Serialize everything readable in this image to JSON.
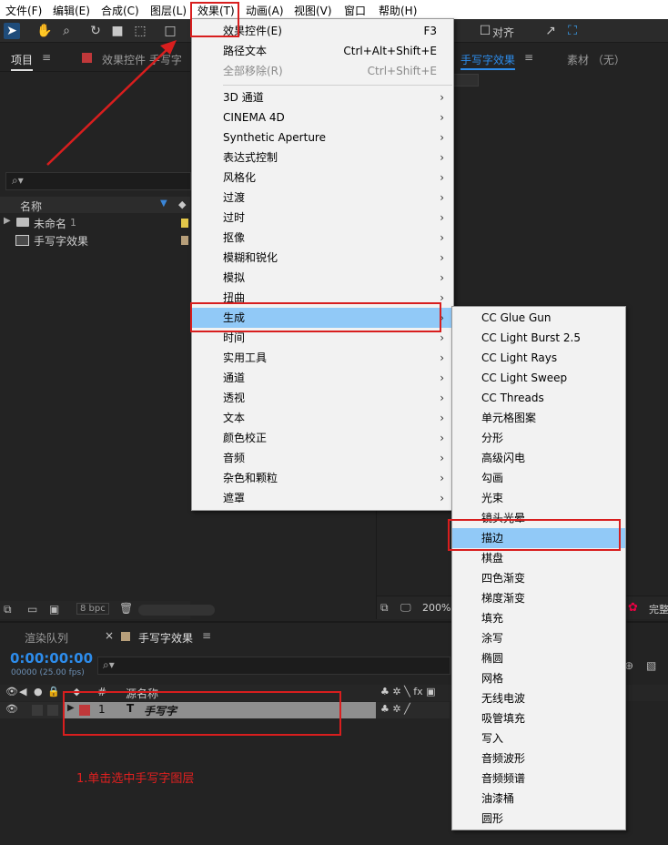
{
  "menubar": {
    "items": [
      "文件(F)",
      "编辑(E)",
      "合成(C)",
      "图层(L)",
      "效果(T)",
      "动画(A)",
      "视图(V)",
      "窗口",
      "帮助(H)"
    ]
  },
  "toolbar": {
    "align_label": "对齐"
  },
  "project_panel": {
    "tab_project": "项目",
    "tab_effect_controls": "效果控件 手写字",
    "col_name": "名称",
    "items": [
      {
        "name": "未命名",
        "count": "1"
      },
      {
        "name": "手写字效果"
      }
    ],
    "bpc": "8 bpc"
  },
  "comp_panel": {
    "tab_comp": "手写字效果",
    "tab_footage": "素材 （无）",
    "zoom": "200%",
    "status": "完整"
  },
  "timeline": {
    "tab_render_queue": "渲染队列",
    "tab_comp": "手写字效果",
    "timecode": "0:00:00:00",
    "timecode_sub": "00000 (25.00 fps)",
    "col_source_name": "源名称",
    "col_index": "#",
    "layer": {
      "index": "1",
      "type_glyph": "T",
      "name": "手写字"
    },
    "annotation": "1.单击选中手写字图层"
  },
  "effect_menu": {
    "items": [
      {
        "label": "效果控件(E)",
        "shortcut": "F3"
      },
      {
        "label": "路径文本",
        "shortcut": "Ctrl+Alt+Shift+E"
      },
      {
        "label": "全部移除(R)",
        "shortcut": "Ctrl+Shift+E",
        "disabled": true
      },
      {
        "label": "3D 通道",
        "submenu": true
      },
      {
        "label": "CINEMA 4D",
        "submenu": true
      },
      {
        "label": "Synthetic Aperture",
        "submenu": true
      },
      {
        "label": "表达式控制",
        "submenu": true
      },
      {
        "label": "风格化",
        "submenu": true
      },
      {
        "label": "过渡",
        "submenu": true
      },
      {
        "label": "过时",
        "submenu": true
      },
      {
        "label": "抠像",
        "submenu": true
      },
      {
        "label": "模糊和锐化",
        "submenu": true
      },
      {
        "label": "模拟",
        "submenu": true
      },
      {
        "label": "扭曲",
        "submenu": true
      },
      {
        "label": "生成",
        "submenu": true,
        "highlighted": true
      },
      {
        "label": "时间",
        "submenu": true
      },
      {
        "label": "实用工具",
        "submenu": true
      },
      {
        "label": "通道",
        "submenu": true
      },
      {
        "label": "透视",
        "submenu": true
      },
      {
        "label": "文本",
        "submenu": true
      },
      {
        "label": "颜色校正",
        "submenu": true
      },
      {
        "label": "音频",
        "submenu": true
      },
      {
        "label": "杂色和颗粒",
        "submenu": true
      },
      {
        "label": "遮罩",
        "submenu": true
      }
    ]
  },
  "generate_menu": {
    "items": [
      {
        "label": "CC Glue Gun"
      },
      {
        "label": "CC Light Burst 2.5"
      },
      {
        "label": "CC Light Rays"
      },
      {
        "label": "CC Light Sweep"
      },
      {
        "label": "CC Threads"
      },
      {
        "label": "单元格图案"
      },
      {
        "label": "分形"
      },
      {
        "label": "高级闪电"
      },
      {
        "label": "勾画"
      },
      {
        "label": "光束"
      },
      {
        "label": "镜头光晕"
      },
      {
        "label": "描边",
        "highlighted": true
      },
      {
        "label": "棋盘"
      },
      {
        "label": "四色渐变"
      },
      {
        "label": "梯度渐变"
      },
      {
        "label": "填充"
      },
      {
        "label": "涂写"
      },
      {
        "label": "椭圆"
      },
      {
        "label": "网格"
      },
      {
        "label": "无线电波"
      },
      {
        "label": "吸管填充"
      },
      {
        "label": "写入"
      },
      {
        "label": "音频波形"
      },
      {
        "label": "音频频谱"
      },
      {
        "label": "油漆桶"
      },
      {
        "label": "圆形"
      }
    ]
  },
  "colors": {
    "highlight": "#91c9f7",
    "annotation_red": "#d81e1e",
    "timecode_blue": "#2d8ceb",
    "layer_label_red": "#c0383a"
  }
}
